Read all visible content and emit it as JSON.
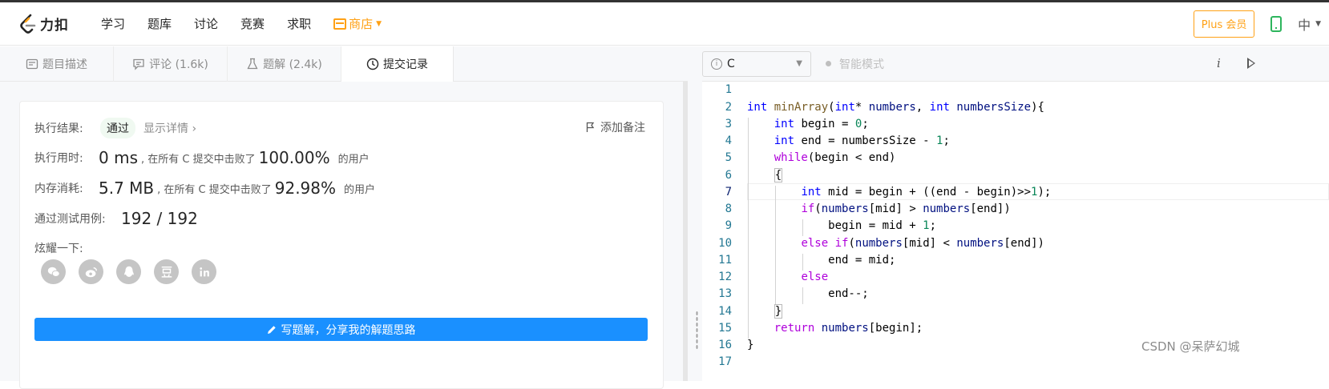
{
  "nav": {
    "logo_text": "力扣",
    "items": [
      "学习",
      "题库",
      "讨论",
      "竞赛",
      "求职"
    ],
    "store_label": "商店",
    "plus_label": "Plus 会员",
    "lang_label": "中"
  },
  "tabs": [
    {
      "label": "题目描述"
    },
    {
      "label": "评论 (1.6k)"
    },
    {
      "label": "题解 (2.4k)"
    },
    {
      "label": "提交记录"
    }
  ],
  "result": {
    "result_label": "执行结果:",
    "status": "通过",
    "detail_link": "显示详情",
    "add_note": "添加备注",
    "time_label": "执行用时:",
    "time_value": "0 ms",
    "time_mid": ", 在所有 C 提交中击败了",
    "time_pct": "100.00%",
    "users_suffix": "的用户",
    "mem_label": "内存消耗:",
    "mem_value": "5.7 MB",
    "mem_mid": ", 在所有 C 提交中击败了",
    "mem_pct": "92.98%",
    "tests_label": "通过测试用例:",
    "tests_value": "192 / 192",
    "share_label": "炫耀一下:",
    "share_icons": [
      "wechat-icon",
      "weibo-icon",
      "qq-icon",
      "douban-icon",
      "linkedin-icon"
    ],
    "write_button": "写题解，分享我的解题思路"
  },
  "editor": {
    "language": "C",
    "smart_mode": "智能模式",
    "info_icon": "i"
  },
  "code_lines": [
    "1",
    "2",
    "3",
    "4",
    "5",
    "6",
    "7",
    "8",
    "9",
    "10",
    "11",
    "12",
    "13",
    "14",
    "15",
    "16",
    "17"
  ],
  "watermark": "CSDN @呆萨幻城",
  "colors": {
    "accent_orange": "#ffa116",
    "primary_blue": "#1a90ff",
    "success_green": "#2db55d"
  }
}
